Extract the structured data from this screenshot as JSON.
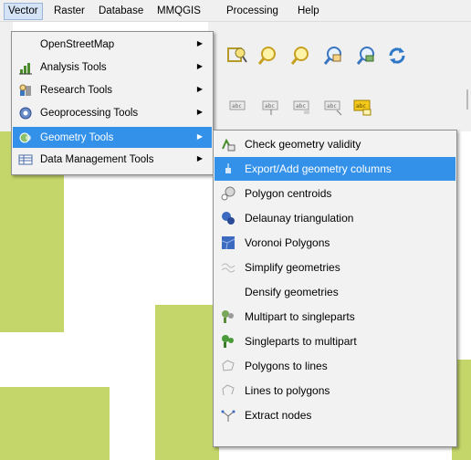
{
  "menubar": {
    "items": [
      "Vector",
      "Raster",
      "Database",
      "MMQGIS",
      "Processing",
      "Help"
    ],
    "active": "Vector"
  },
  "vector_menu": {
    "items": [
      {
        "label": "OpenStreetMap",
        "icon": "none",
        "submenu": true
      },
      {
        "label": "Analysis Tools",
        "icon": "analysis-icon",
        "submenu": true
      },
      {
        "label": "Research Tools",
        "icon": "research-icon",
        "submenu": true
      },
      {
        "label": "Geoprocessing Tools",
        "icon": "geoprocessing-icon",
        "submenu": true
      },
      {
        "label": "Geometry Tools",
        "icon": "geometry-icon",
        "submenu": true,
        "highlighted": true
      },
      {
        "label": "Data Management Tools",
        "icon": "data-management-icon",
        "submenu": true
      }
    ]
  },
  "geometry_menu": {
    "items": [
      {
        "label": "Check geometry validity",
        "icon": "check-validity-icon"
      },
      {
        "label": "Export/Add geometry columns",
        "icon": "export-geometry-icon",
        "highlighted": true
      },
      {
        "label": "Polygon centroids",
        "icon": "centroids-icon"
      },
      {
        "label": "Delaunay triangulation",
        "icon": "delaunay-icon"
      },
      {
        "label": "Voronoi Polygons",
        "icon": "voronoi-icon"
      },
      {
        "label": "Simplify geometries",
        "icon": "simplify-icon"
      },
      {
        "label": "Densify geometries",
        "icon": "none"
      },
      {
        "label": "Multipart to singleparts",
        "icon": "multipart-icon"
      },
      {
        "label": "Singleparts to multipart",
        "icon": "singlepart-icon"
      },
      {
        "label": "Polygons to lines",
        "icon": "polygons-to-lines-icon"
      },
      {
        "label": "Lines to polygons",
        "icon": "lines-to-polygons-icon"
      },
      {
        "label": "Extract nodes",
        "icon": "extract-nodes-icon"
      }
    ]
  },
  "colors": {
    "highlight": "#3391ea",
    "map_fill": "#c4d66a",
    "menu_bg": "#f2f2f2"
  }
}
